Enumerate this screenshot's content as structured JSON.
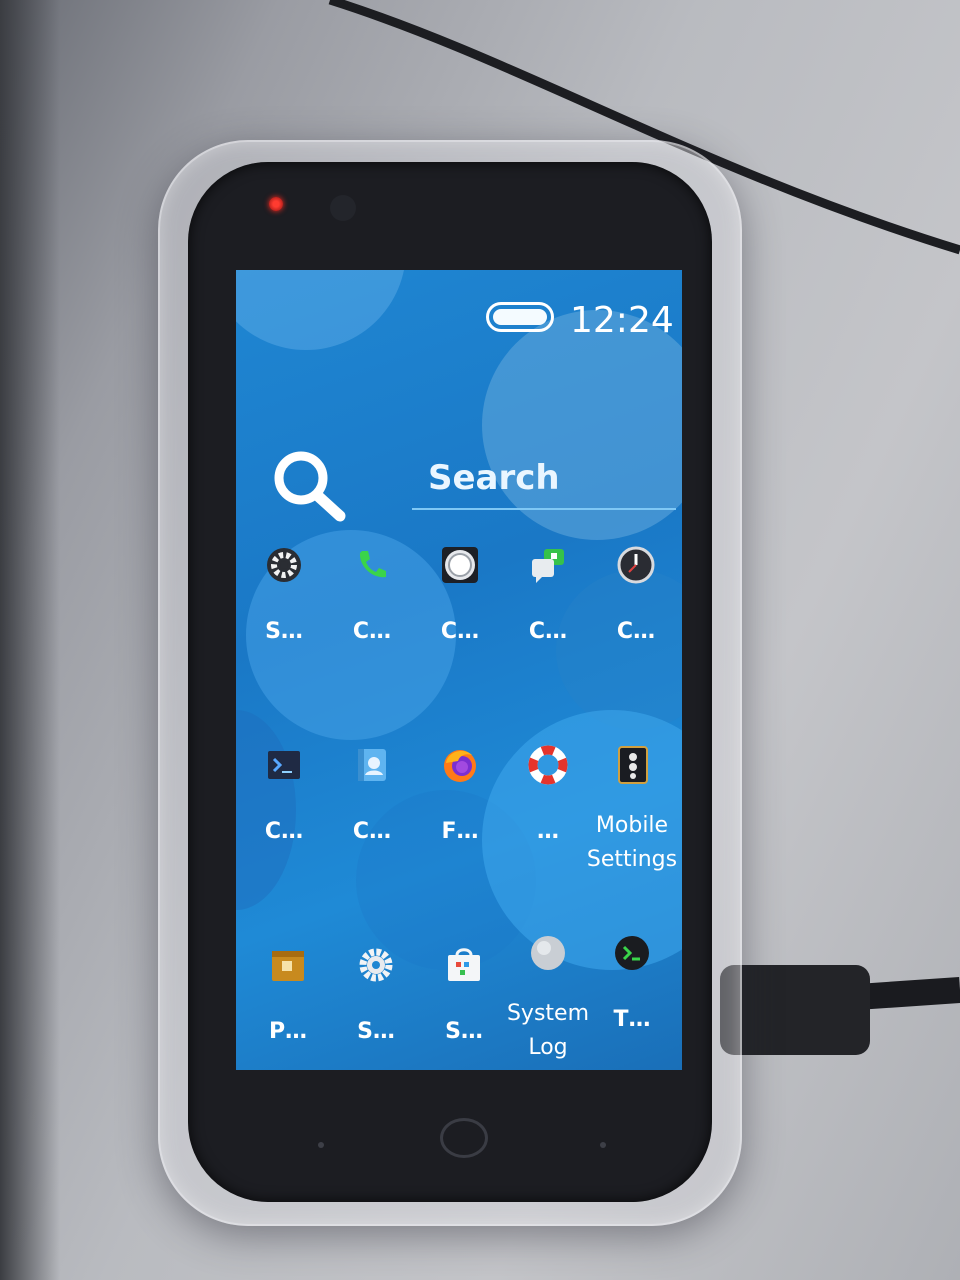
{
  "status_bar": {
    "time": "12:24",
    "battery_level": 1.0
  },
  "search": {
    "placeholder": "Search"
  },
  "apps": [
    {
      "label": "S…",
      "icon": "gear-icon"
    },
    {
      "label": "C…",
      "icon": "phone-icon"
    },
    {
      "label": "C…",
      "icon": "camera-icon"
    },
    {
      "label": "C…",
      "icon": "chat-icon"
    },
    {
      "label": "C…",
      "icon": "clock-icon"
    },
    {
      "label": "C…",
      "icon": "console-icon"
    },
    {
      "label": "C…",
      "icon": "contacts-icon"
    },
    {
      "label": "F…",
      "icon": "firefox-icon"
    },
    {
      "label": "…",
      "icon": "lifebuoy-icon"
    },
    {
      "label": "Mobile Settings",
      "icon": "mobile-settings-icon"
    },
    {
      "label": "P…",
      "icon": "package-icon"
    },
    {
      "label": "S…",
      "icon": "settings-gear-icon"
    },
    {
      "label": "S…",
      "icon": "store-icon"
    },
    {
      "label": "System Log",
      "icon": "system-log-icon"
    },
    {
      "label": "T…",
      "icon": "terminal-icon"
    }
  ],
  "colors": {
    "wallpaper": "#1f86d2",
    "accent": "#7fc8f5",
    "text": "#ffffff"
  }
}
